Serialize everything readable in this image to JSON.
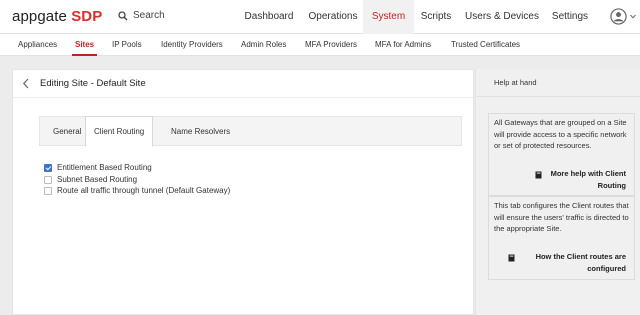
{
  "brand": {
    "name_a": "appgate",
    "name_b": "SDP"
  },
  "search": {
    "label": "Search"
  },
  "nav": {
    "items": [
      {
        "label": "Dashboard"
      },
      {
        "label": "Operations"
      },
      {
        "label": "System"
      },
      {
        "label": "Scripts"
      },
      {
        "label": "Users & Devices"
      },
      {
        "label": "Settings"
      }
    ]
  },
  "subnav": {
    "items": [
      {
        "label": "Appliances"
      },
      {
        "label": "Sites"
      },
      {
        "label": "IP Pools"
      },
      {
        "label": "Identity Providers"
      },
      {
        "label": "Admin Roles"
      },
      {
        "label": "MFA Providers"
      },
      {
        "label": "MFA for Admins"
      },
      {
        "label": "Trusted Certificates"
      }
    ]
  },
  "page": {
    "title": "Editing Site - Default Site"
  },
  "tabs": [
    {
      "label": "General"
    },
    {
      "label": "Client Routing"
    },
    {
      "label": "Name Resolvers"
    }
  ],
  "options": [
    {
      "label": "Entitlement Based Routing",
      "checked": true
    },
    {
      "label": "Subnet Based Routing",
      "checked": false
    },
    {
      "label": "Route all traffic through tunnel (Default Gateway)",
      "checked": false
    }
  ],
  "help": {
    "title": "Help at hand",
    "card1": {
      "text": "All Gateways that are grouped on a Site will provide access to a specific network or set of protected resources.",
      "link_line1": "More help with Client",
      "link_line2": "Routing"
    },
    "card2": {
      "text": "This tab configures the Client routes that will ensure the users' traffic is directed to the appropriate Site.",
      "link_line1": "How the Client routes are",
      "link_line2": "configured"
    }
  },
  "colors": {
    "accent": "#c0241f",
    "checkbox": "#3a73c8"
  }
}
